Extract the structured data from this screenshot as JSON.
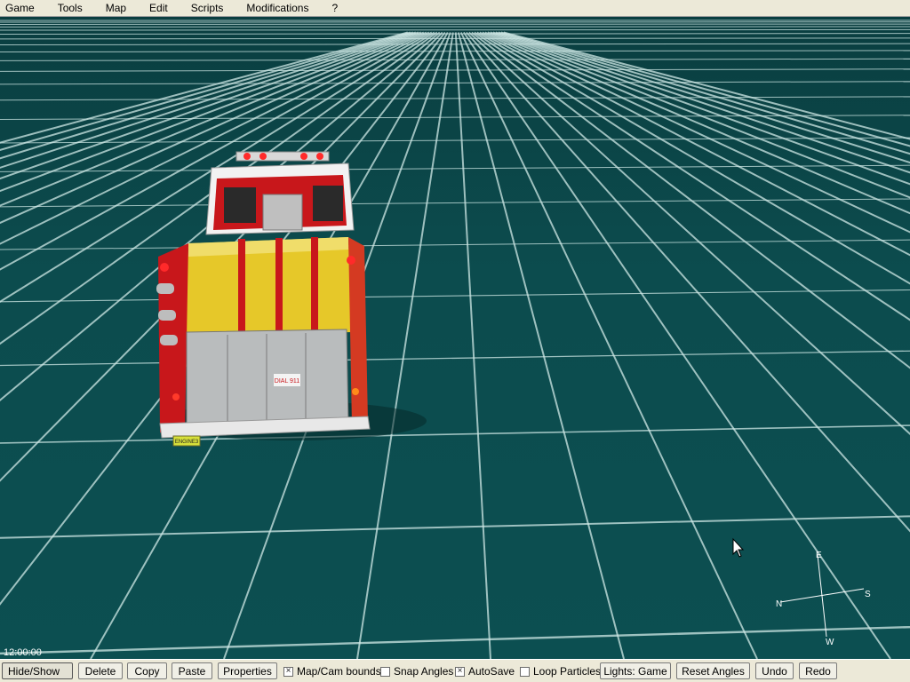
{
  "menu": {
    "items": [
      "Game",
      "Tools",
      "Map",
      "Edit",
      "Scripts",
      "Modifications",
      "?"
    ]
  },
  "viewport": {
    "clock": "12:00:00",
    "vehicle": {
      "plate_text": "ENGINE3",
      "decal_text": "DIAL 911"
    },
    "compass": {
      "north": "N",
      "south": "S",
      "east": "E",
      "west": "W"
    }
  },
  "toolbar": {
    "hide_show": "Hide/Show",
    "delete": "Delete",
    "copy": "Copy",
    "paste": "Paste",
    "properties": "Properties",
    "map_cam_bounds": {
      "label": "Map/Cam bounds",
      "checked": true
    },
    "snap_angles": {
      "label": "Snap Angles",
      "checked": false
    },
    "autosave": {
      "label": "AutoSave",
      "checked": true
    },
    "loop_particles": {
      "label": "Loop Particles",
      "checked": false
    },
    "lights": "Lights: Game",
    "reset_angles": "Reset Angles",
    "undo": "Undo",
    "redo": "Redo"
  },
  "colors": {
    "ground": "#0c4c4e",
    "grid": "#cfe8e6",
    "truck_red": "#c8171b",
    "hose_yellow": "#e6c829",
    "toolbar_bg": "#ece9d8"
  }
}
